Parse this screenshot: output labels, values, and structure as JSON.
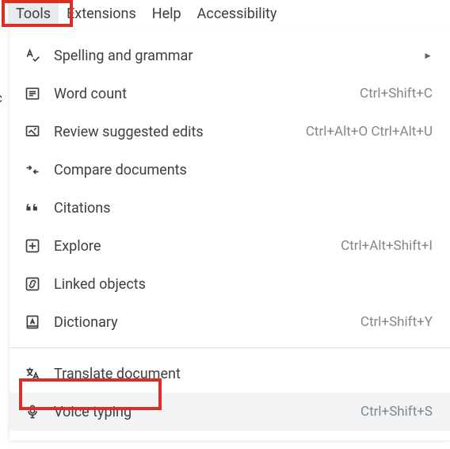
{
  "menubar": {
    "items": [
      {
        "label": "Tools",
        "active": true
      },
      {
        "label": "Extensions",
        "active": false
      },
      {
        "label": "Help",
        "active": false
      },
      {
        "label": "Accessibility",
        "active": false
      }
    ]
  },
  "menu": {
    "items": [
      {
        "icon": "spellcheck-icon",
        "label": "Spelling and grammar",
        "shortcut": "",
        "hasSubmenu": true
      },
      {
        "icon": "wordcount-icon",
        "label": "Word count",
        "shortcut": "Ctrl+Shift+C"
      },
      {
        "icon": "review-icon",
        "label": "Review suggested edits",
        "shortcut": "Ctrl+Alt+O Ctrl+Alt+U"
      },
      {
        "icon": "compare-icon",
        "label": "Compare documents",
        "shortcut": ""
      },
      {
        "icon": "citations-icon",
        "label": "Citations",
        "shortcut": ""
      },
      {
        "icon": "explore-icon",
        "label": "Explore",
        "shortcut": "Ctrl+Alt+Shift+I"
      },
      {
        "icon": "linked-icon",
        "label": "Linked objects",
        "shortcut": ""
      },
      {
        "icon": "dictionary-icon",
        "label": "Dictionary",
        "shortcut": "Ctrl+Shift+Y"
      },
      {
        "divider": true
      },
      {
        "icon": "translate-icon",
        "label": "Translate document",
        "shortcut": ""
      },
      {
        "icon": "mic-icon",
        "label": "Voice typing",
        "shortcut": "Ctrl+Shift+S",
        "hovered": true
      }
    ]
  },
  "arrow_glyph": "►"
}
